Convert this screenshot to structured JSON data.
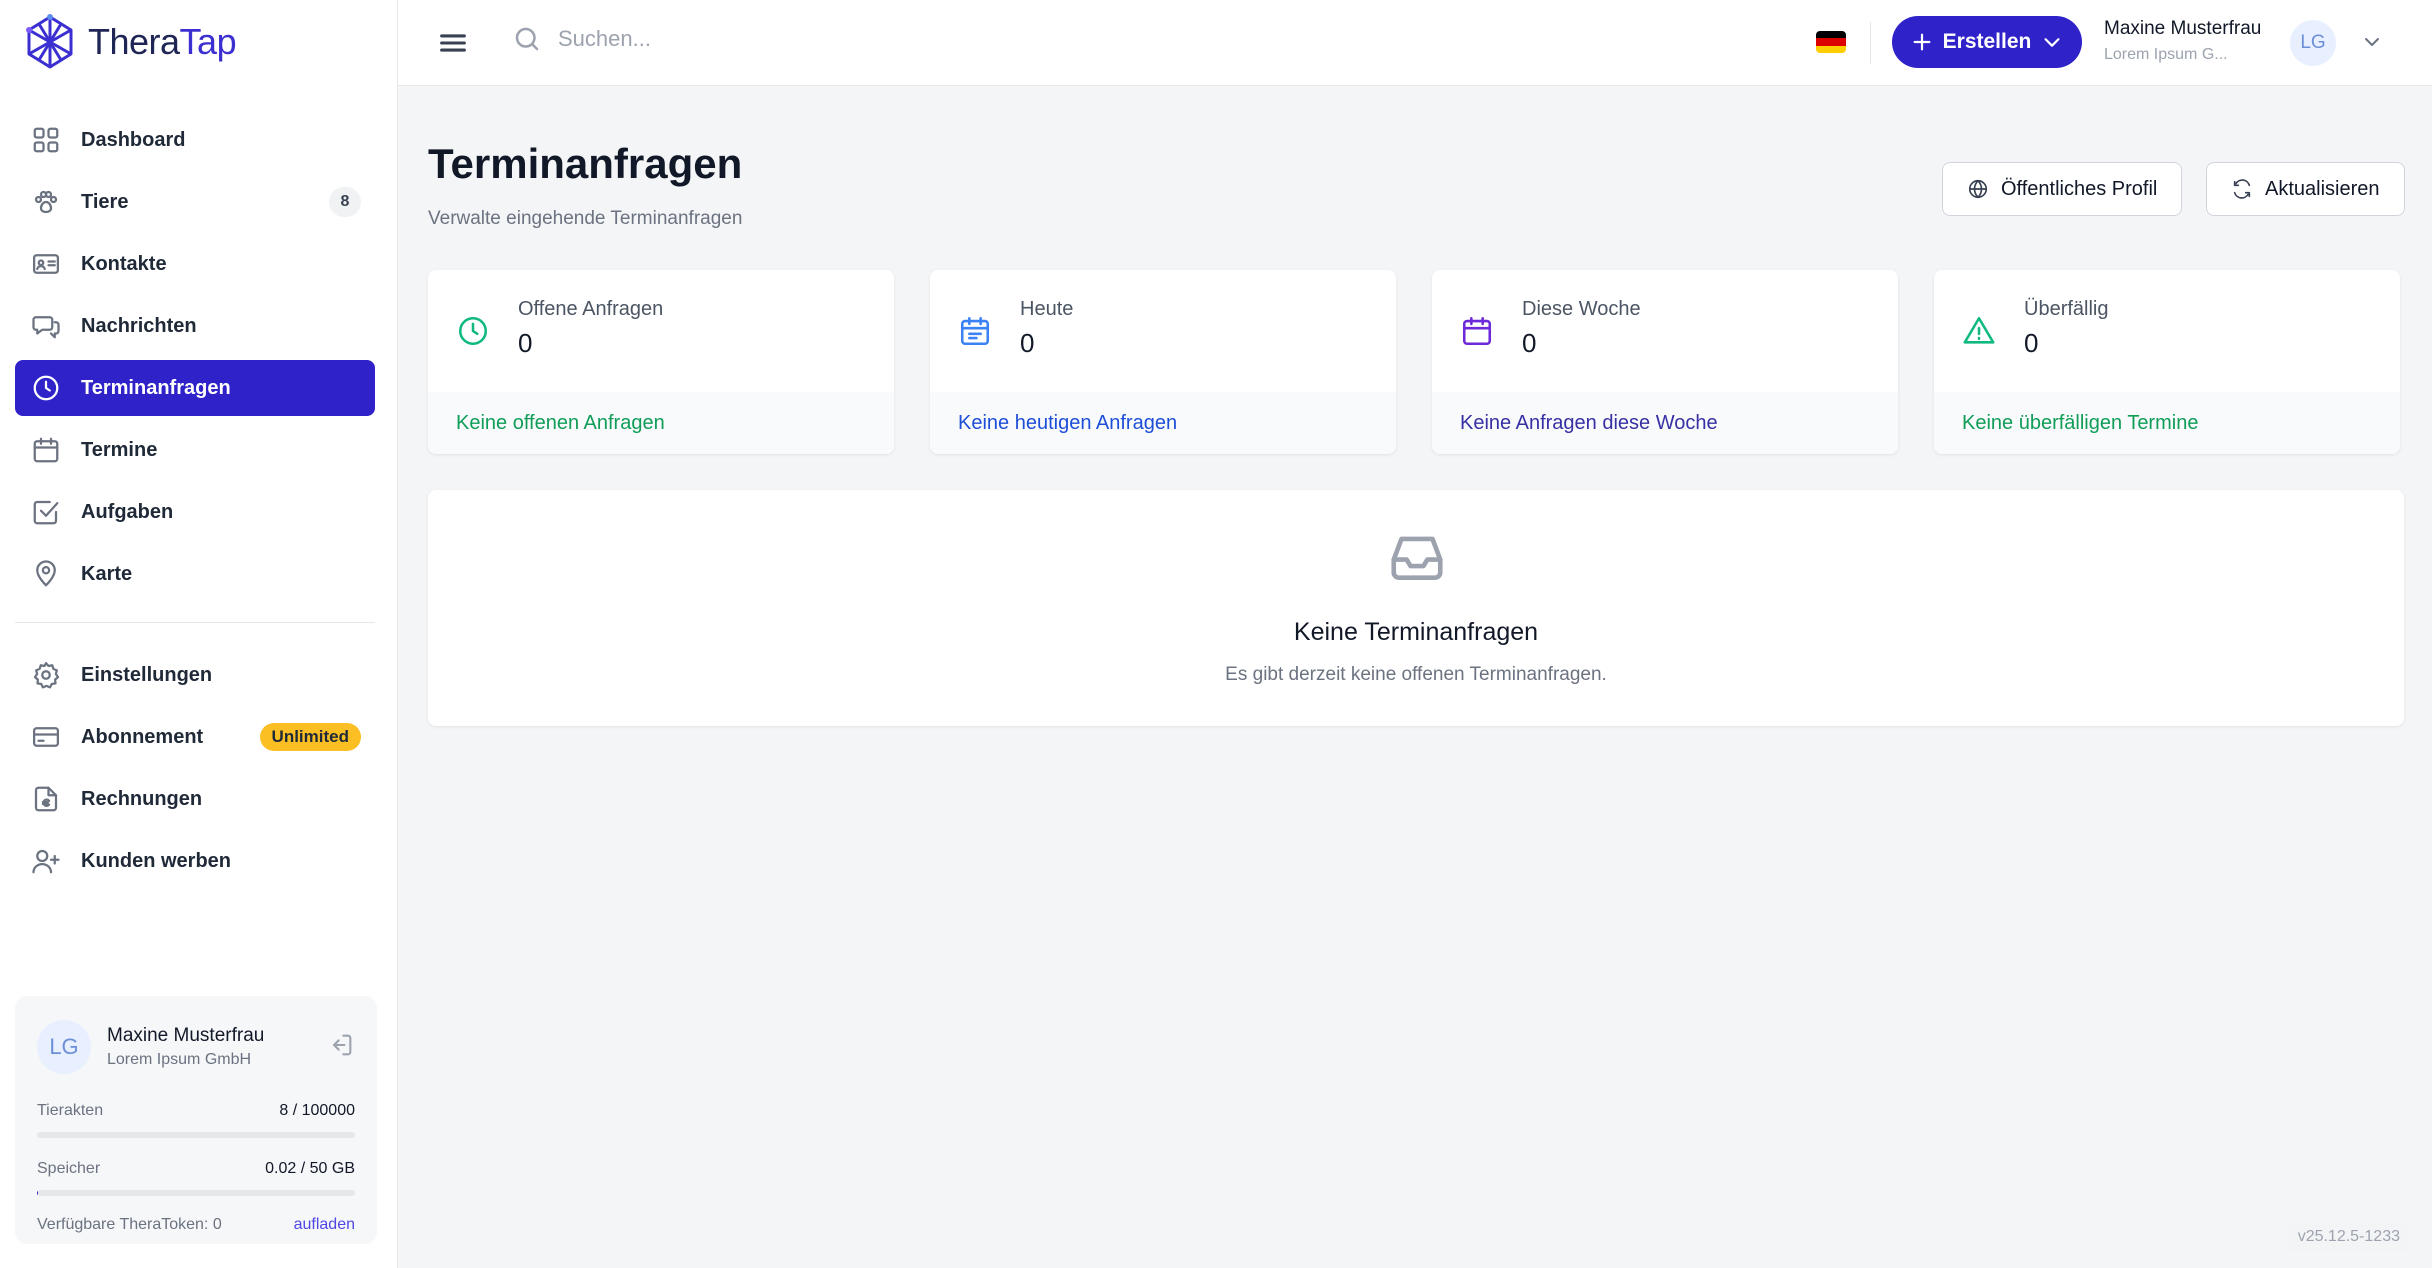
{
  "brand": {
    "name_part1": "Thera",
    "name_part2": "Tap",
    "colors": {
      "primary": "#2f22c9",
      "accent_green": "#0f9d58",
      "warning": "#fbbf24"
    }
  },
  "sidebar": {
    "items": [
      {
        "label": "Dashboard",
        "icon": "grid-icon"
      },
      {
        "label": "Tiere",
        "icon": "paw-icon",
        "badge": "8"
      },
      {
        "label": "Kontakte",
        "icon": "contact-card-icon"
      },
      {
        "label": "Nachrichten",
        "icon": "chat-icon"
      },
      {
        "label": "Terminanfragen",
        "icon": "clock-icon",
        "active": true
      },
      {
        "label": "Termine",
        "icon": "calendar-icon"
      },
      {
        "label": "Aufgaben",
        "icon": "checkbox-icon"
      },
      {
        "label": "Karte",
        "icon": "map-pin-icon"
      }
    ],
    "secondary_items": [
      {
        "label": "Einstellungen",
        "icon": "gear-icon"
      },
      {
        "label": "Abonnement",
        "icon": "credit-card-icon",
        "badge": "Unlimited"
      },
      {
        "label": "Rechnungen",
        "icon": "invoice-icon"
      },
      {
        "label": "Kunden werben",
        "icon": "user-plus-icon"
      }
    ],
    "user_card": {
      "initials": "LG",
      "name": "Maxine Musterfrau",
      "company": "Lorem Ipsum GmbH",
      "records_label": "Tierakten",
      "records_value": "8 / 100000",
      "records_fraction": 8e-05,
      "storage_label": "Speicher",
      "storage_value": "0.02 / 50 GB",
      "storage_fraction": 0.0004,
      "tokens_label": "Verfügbare TheraToken: 0",
      "tokens_link": "aufladen"
    }
  },
  "topbar": {
    "search_placeholder": "Suchen...",
    "language": "de",
    "create_label": "Erstellen",
    "user_name": "Maxine Musterfrau",
    "user_company": "Lorem Ipsum G...",
    "user_initials": "LG"
  },
  "main": {
    "title": "Terminanfragen",
    "subtitle": "Verwalte eingehende Terminanfragen",
    "public_profile_label": "Öffentliches Profil",
    "refresh_label": "Aktualisieren",
    "stats": [
      {
        "label": "Offene Anfragen",
        "value": "0",
        "footer": "Keine offenen Anfragen",
        "icon": "clock-icon",
        "color": "#10b981",
        "footer_color": "#0f9d58"
      },
      {
        "label": "Heute",
        "value": "0",
        "footer": "Keine heutigen Anfragen",
        "icon": "calendar-day-icon",
        "color": "#3b82f6",
        "footer_color": "#1d4ed8"
      },
      {
        "label": "Diese Woche",
        "value": "0",
        "footer": "Keine Anfragen diese Woche",
        "icon": "calendar-icon",
        "color": "#6d28d9",
        "footer_color": "#3730a3"
      },
      {
        "label": "Überfällig",
        "value": "0",
        "footer": "Keine überfälligen Termine",
        "icon": "warning-icon",
        "color": "#10b981",
        "footer_color": "#0f9d58"
      }
    ],
    "empty": {
      "title": "Keine Terminanfragen",
      "subtitle": "Es gibt derzeit keine offenen Terminanfragen."
    }
  },
  "version": "v25.12.5-1233"
}
